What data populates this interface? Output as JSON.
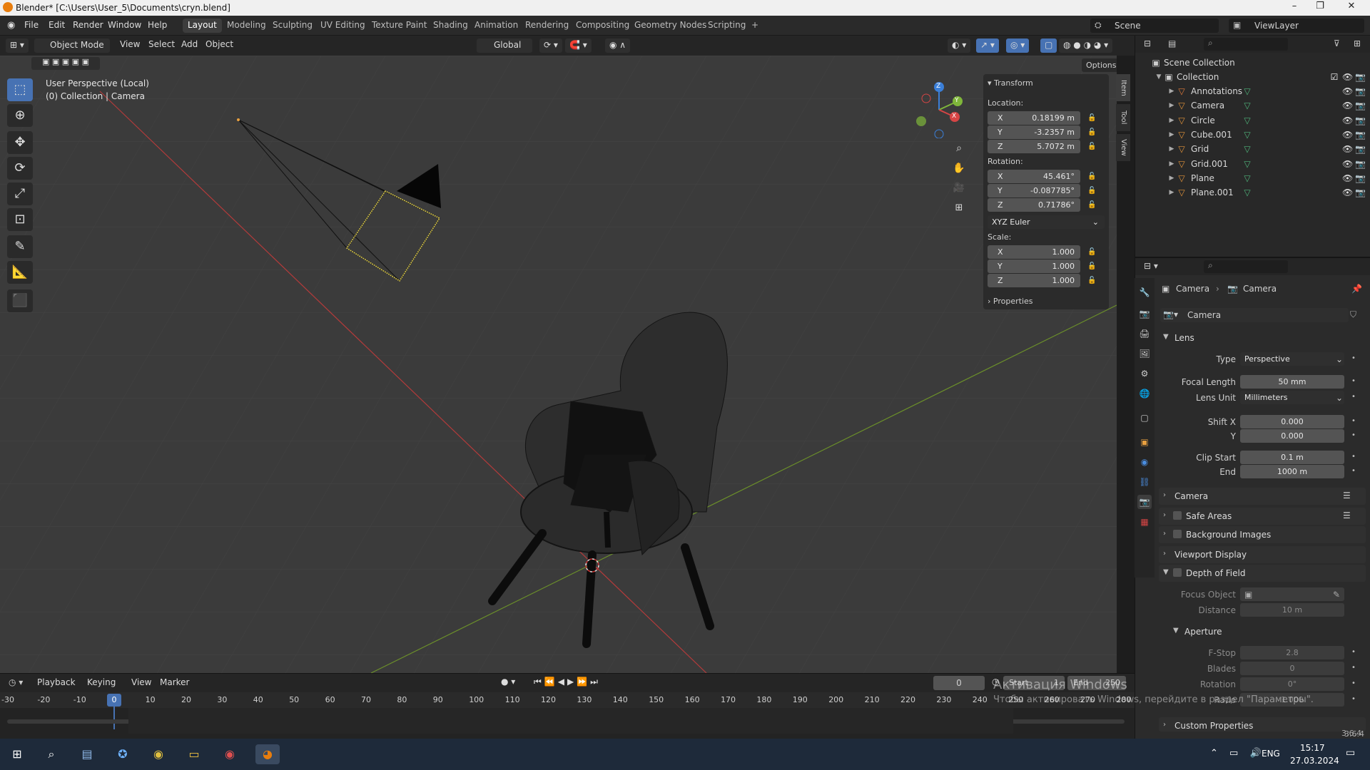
{
  "app": {
    "title": "Blender* [C:\\Users\\User_5\\Documents\\cryn.blend]"
  },
  "window_controls": {
    "minimize": "–",
    "maximize": "❐",
    "close": "✕"
  },
  "menu": {
    "items": [
      "File",
      "Edit",
      "Render",
      "Window",
      "Help"
    ]
  },
  "workspaces": {
    "tabs": [
      "Layout",
      "Modeling",
      "Sculpting",
      "UV Editing",
      "Texture Paint",
      "Shading",
      "Animation",
      "Rendering",
      "Compositing",
      "Geometry Nodes",
      "Scripting",
      "+"
    ],
    "active": "Layout"
  },
  "scene": {
    "label": "Scene",
    "viewlayer": "ViewLayer"
  },
  "header": {
    "mode": "Object Mode",
    "view": "View",
    "select": "Select",
    "add": "Add",
    "object": "Object",
    "orientation": "Global",
    "options": "Options"
  },
  "viewport": {
    "persp": "User Perspective (Local)",
    "collection": "(0) Collection | Camera",
    "gizmo": {
      "x": "X",
      "y": "Y",
      "z": "Z"
    }
  },
  "npanel": {
    "tabs": [
      "Item",
      "Tool",
      "View"
    ],
    "transform_title": "Transform",
    "location_label": "Location:",
    "location": [
      {
        "axis": "X",
        "value": "0.18199 m"
      },
      {
        "axis": "Y",
        "value": "-3.2357 m"
      },
      {
        "axis": "Z",
        "value": "5.7072 m"
      }
    ],
    "rotation_label": "Rotation:",
    "rotation": [
      {
        "axis": "X",
        "value": "45.461°"
      },
      {
        "axis": "Y",
        "value": "-0.087785°"
      },
      {
        "axis": "Z",
        "value": "0.71786°"
      }
    ],
    "rotation_mode": "XYZ Euler",
    "scale_label": "Scale:",
    "scale": [
      {
        "axis": "X",
        "value": "1.000"
      },
      {
        "axis": "Y",
        "value": "1.000"
      },
      {
        "axis": "Z",
        "value": "1.000"
      }
    ],
    "properties_title": "Properties"
  },
  "outliner": {
    "scene_collection": "Scene Collection",
    "collection": "Collection",
    "items": [
      {
        "name": "Annotations",
        "color": "#e07a3a"
      },
      {
        "name": "Camera",
        "color": "#e0923a"
      },
      {
        "name": "Circle",
        "color": "#e0923a"
      },
      {
        "name": "Cube.001",
        "color": "#e0923a"
      },
      {
        "name": "Grid",
        "color": "#e0923a"
      },
      {
        "name": "Grid.001",
        "color": "#e0923a"
      },
      {
        "name": "Plane",
        "color": "#e0923a"
      },
      {
        "name": "Plane.001",
        "color": "#e0923a"
      }
    ]
  },
  "properties": {
    "breadcrumb": [
      "Camera",
      "Camera"
    ],
    "datablock": "Camera",
    "lens_section": "Lens",
    "rows": [
      {
        "label": "Type",
        "value": "Perspective",
        "type": "select"
      },
      {
        "label": "Focal Length",
        "value": "50 mm"
      },
      {
        "label": "Lens Unit",
        "value": "Millimeters",
        "type": "select"
      },
      {
        "label": "Shift X",
        "value": "0.000"
      },
      {
        "label": "Y",
        "value": "0.000"
      },
      {
        "label": "Clip Start",
        "value": "0.1 m"
      },
      {
        "label": "End",
        "value": "1000 m"
      }
    ],
    "sections": [
      "Camera",
      "Safe Areas",
      "Background Images",
      "Viewport Display",
      "Depth of Field"
    ],
    "dof_rows": [
      {
        "label": "Focus Object",
        "value": ""
      },
      {
        "label": "Distance",
        "value": "10 m"
      }
    ],
    "aperture": "Aperture",
    "aperture_rows": [
      {
        "label": "F-Stop",
        "value": "2.8"
      },
      {
        "label": "Blades",
        "value": "0"
      },
      {
        "label": "Rotation",
        "value": "0°"
      },
      {
        "label": "Ratio",
        "value": "1.000"
      }
    ],
    "custom": "Custom Properties"
  },
  "timeline": {
    "menus": [
      "Playback",
      "Keying",
      "View",
      "Marker"
    ],
    "current_frame": "0",
    "start_label": "Start",
    "start": "1",
    "end_label": "End",
    "end": "250",
    "ticks": [
      "-30",
      "-20",
      "-10",
      "0",
      "10",
      "20",
      "30",
      "40",
      "50",
      "60",
      "70",
      "80",
      "90",
      "100",
      "110",
      "120",
      "130",
      "140",
      "150",
      "160",
      "170",
      "180",
      "190",
      "200",
      "210",
      "220",
      "230",
      "240",
      "250",
      "260",
      "270",
      "280"
    ],
    "version": "3.6.4"
  },
  "watermark": {
    "line1": "Активация Windows",
    "line2": "Чтобы активировать Windows, перейдите в раздел \"Параметры\"."
  },
  "taskbar": {
    "lang": "ENG",
    "time": "15:17",
    "date": "27.03.2024"
  }
}
